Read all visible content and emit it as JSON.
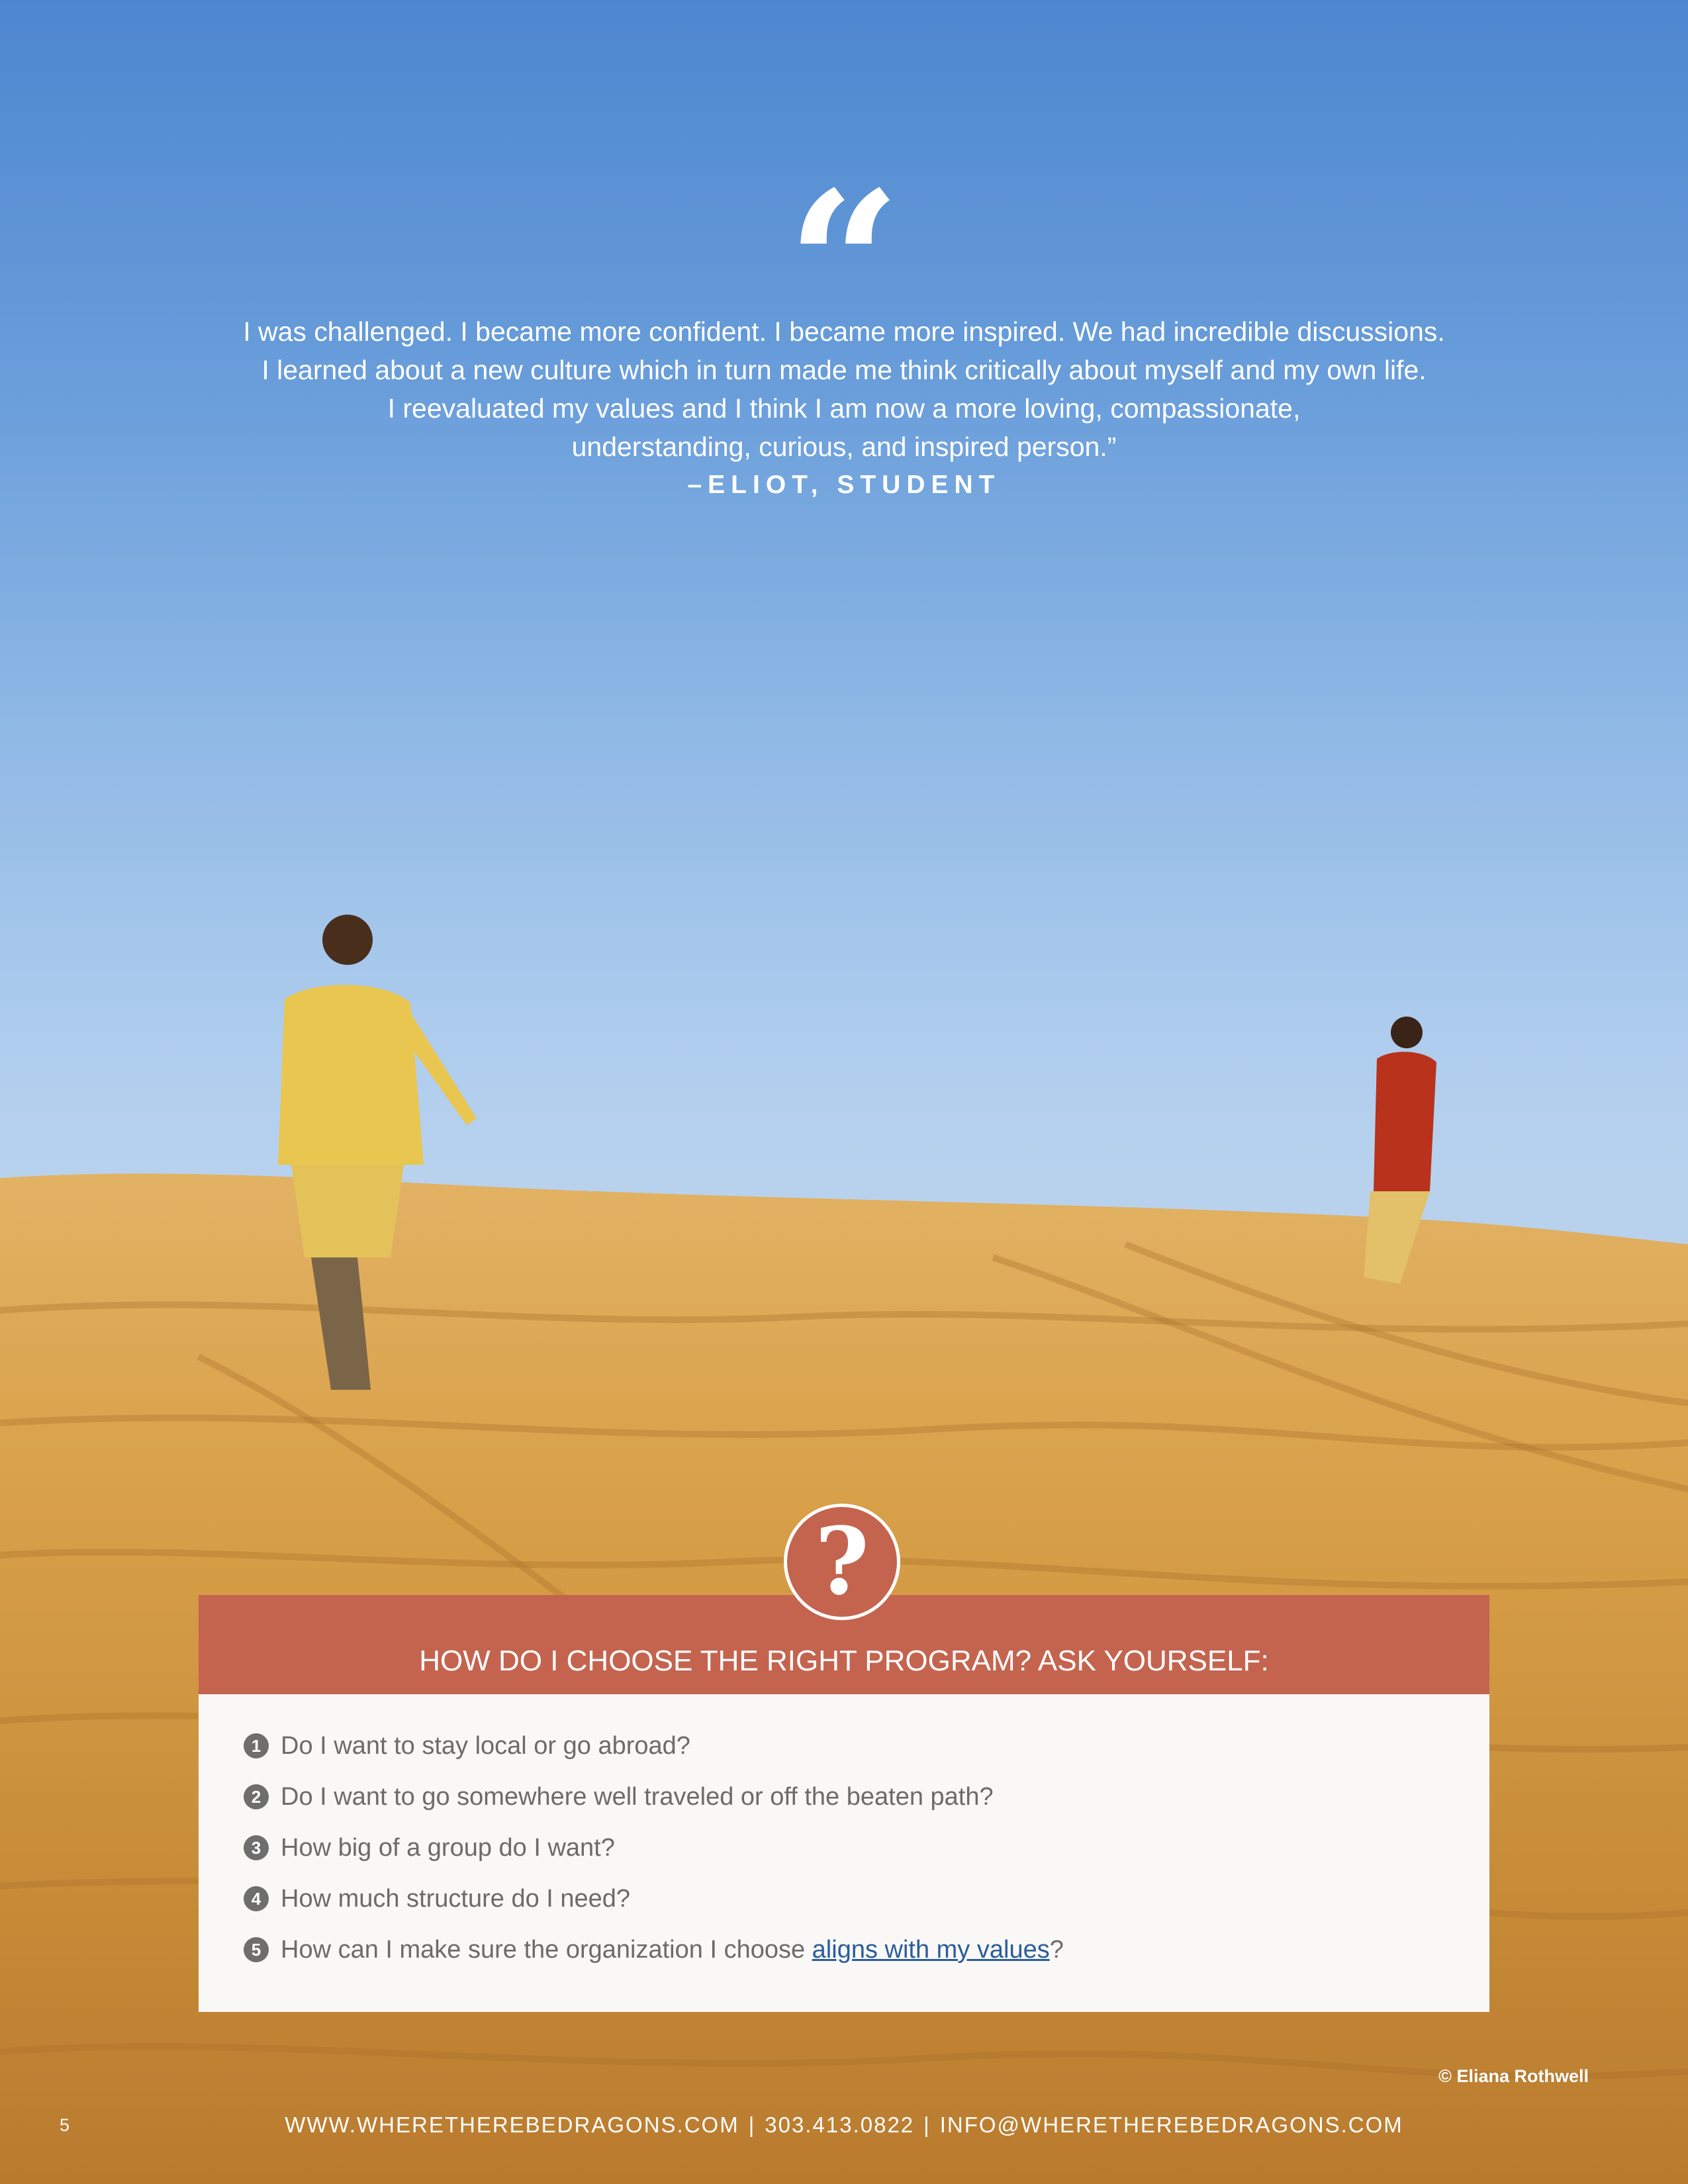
{
  "quote": {
    "mark": "“",
    "lines": [
      "I was challenged. I became more confident. I became more inspired. We had incredible discussions.",
      "I learned about a new culture which in turn made me think critically about myself and my own life.",
      "I reevaluated my values and I think I am now a more loving, compassionate,",
      "understanding, curious, and inspired person.”"
    ],
    "attribution": "–ELIOT, STUDENT"
  },
  "question_box": {
    "badge": "?",
    "title": "HOW DO I CHOOSE THE RIGHT PROGRAM? ASK YOURSELF:",
    "items": [
      {
        "num": "1",
        "text": "Do I want to stay local or go abroad?"
      },
      {
        "num": "2",
        "text": "Do I want to go somewhere well traveled or off the beaten path?"
      },
      {
        "num": "3",
        "text": "How big of a group do I want?"
      },
      {
        "num": "4",
        "text": "How much structure do I need?"
      },
      {
        "num": "5",
        "text": "How can I make sure the organization I choose ",
        "link": "aligns with my values",
        "suffix": "?"
      }
    ]
  },
  "photo_credit": "© Eliana Rothwell",
  "footer": {
    "page_number": "5",
    "website": "WWW.WHERETHEREBEDRAGONS.COM",
    "separator": "|",
    "phone": "303.413.0822",
    "email": "INFO@WHERETHEREBEDRAGONS.COM"
  },
  "colors": {
    "sky_top": "#4d87cf",
    "sky_bottom": "#b8d2ee",
    "sand": "#d9a54c",
    "accent": "#c4644f",
    "link": "#2b5d9a"
  }
}
